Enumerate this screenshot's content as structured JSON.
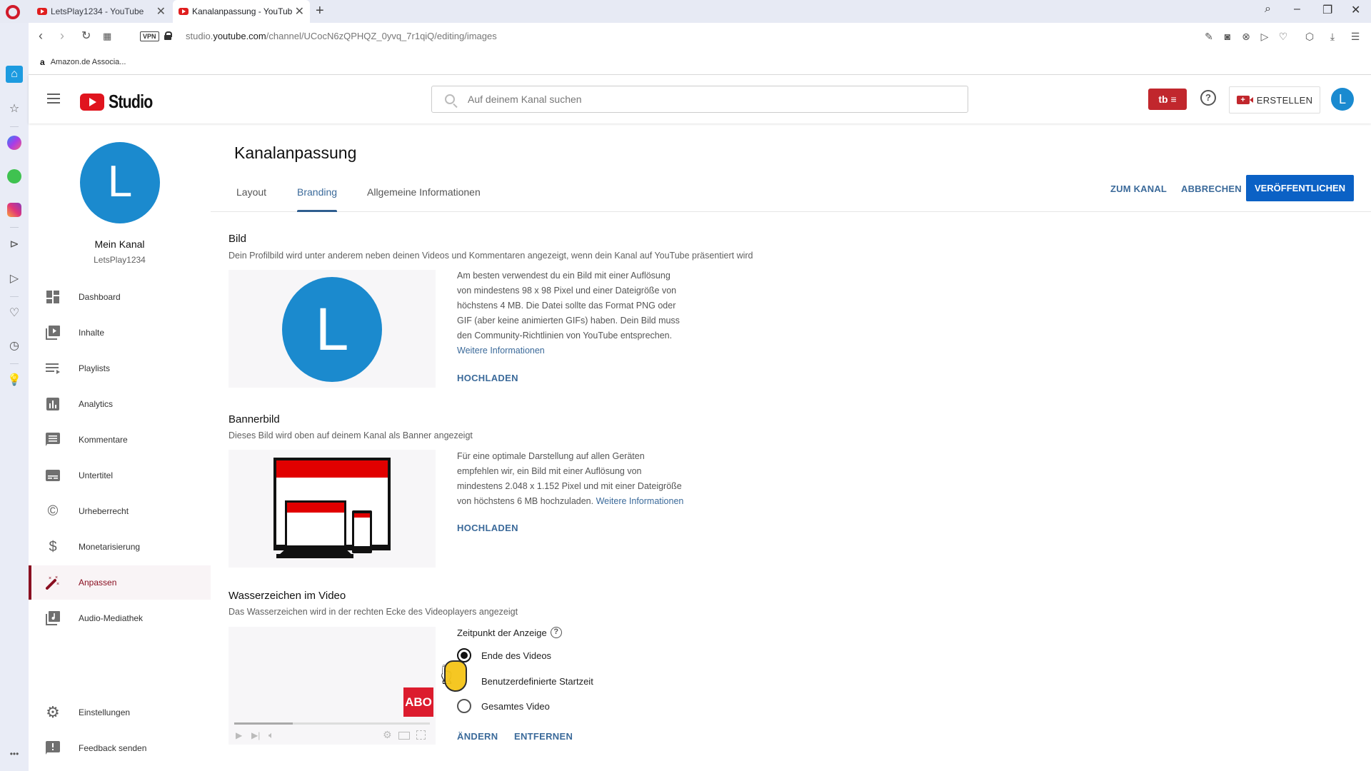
{
  "browser": {
    "tabs": [
      {
        "title": "LetsPlay1234 - YouTube",
        "active": false
      },
      {
        "title": "Kanalanpassung - YouTube",
        "active": true
      }
    ],
    "new_tab": "+",
    "url_prefix": "studio.",
    "url_domain": "youtube.com",
    "url_path": "/channel/UCocN6zQPHQZ_0yvq_7r1qiQ/editing/images",
    "vpn_label": "VPN",
    "bookmarks": [
      {
        "icon": "a",
        "label": "Amazon.de Associa..."
      }
    ],
    "window_controls": {
      "search": "⌕",
      "minimize": "–",
      "restore": "❐",
      "close": "✕"
    },
    "toolbar_icons": [
      "snapshot-edit",
      "camera",
      "adblock",
      "send",
      "heart",
      "cube",
      "download",
      "settings"
    ]
  },
  "opera_sidebar": {
    "items": [
      "home",
      "star",
      "messenger",
      "whatsapp",
      "instagram",
      "player",
      "send",
      "heart",
      "history",
      "tips"
    ],
    "more": "•••"
  },
  "header": {
    "logo_text": "Studio",
    "search_placeholder": "Auf deinem Kanal suchen",
    "tb_label": "tb ≡",
    "help": "?",
    "create_label": "ERSTELLEN",
    "avatar_letter": "L"
  },
  "nav": {
    "channel_avatar": "L",
    "channel_name": "Mein Kanal",
    "channel_handle": "LetsPlay1234",
    "items": [
      {
        "label": "Dashboard",
        "icon": "dashboard-icon"
      },
      {
        "label": "Inhalte",
        "icon": "content-icon"
      },
      {
        "label": "Playlists",
        "icon": "playlist-icon"
      },
      {
        "label": "Analytics",
        "icon": "analytics-icon"
      },
      {
        "label": "Kommentare",
        "icon": "comments-icon"
      },
      {
        "label": "Untertitel",
        "icon": "subtitles-icon"
      },
      {
        "label": "Urheberrecht",
        "icon": "copyright-icon"
      },
      {
        "label": "Monetarisierung",
        "icon": "dollar-icon"
      },
      {
        "label": "Anpassen",
        "icon": "magic-wand-icon",
        "active": true
      },
      {
        "label": "Audio-Mediathek",
        "icon": "audio-library-icon"
      }
    ],
    "bottom_items": [
      {
        "label": "Einstellungen",
        "icon": "gear-icon"
      },
      {
        "label": "Feedback senden",
        "icon": "feedback-icon"
      }
    ]
  },
  "main": {
    "title": "Kanalanpassung",
    "tabs": [
      {
        "label": "Layout",
        "active": false
      },
      {
        "label": "Branding",
        "active": true
      },
      {
        "label": "Allgemeine Informationen",
        "active": false
      }
    ],
    "actions": {
      "to_channel": "ZUM KANAL",
      "cancel": "ABBRECHEN",
      "publish": "VERÖFFENTLICHEN"
    },
    "accent_color": "#0b61c5",
    "sections": {
      "picture": {
        "title": "Bild",
        "description": "Dein Profilbild wird unter anderem neben deinen Videos und Kommentaren angezeigt, wenn dein Kanal auf YouTube präsentiert wird",
        "avatar_letter": "L",
        "info": "Am besten verwendest du ein Bild mit einer Auflösung von mindestens 98 x 98 Pixel und einer Dateigröße von höchstens 4 MB. Die Datei sollte das Format PNG oder GIF (aber keine animierten GIFs) haben. Dein Bild muss den Community-Richtlinien von YouTube entsprechen.",
        "info_lines": [
          "Am besten verwendest du ein Bild mit einer Auflösung",
          "von mindestens 98 x 98 Pixel und einer Dateigröße von",
          "höchstens 4 MB. Die Datei sollte das Format PNG oder",
          "GIF (aber keine animierten GIFs) haben. Dein Bild muss",
          "den Community-Richtlinien von YouTube entsprechen."
        ],
        "more_link": "Weitere Informationen",
        "upload": "HOCHLADEN"
      },
      "banner": {
        "title": "Bannerbild",
        "description": "Dieses Bild wird oben auf deinem Kanal als Banner angezeigt",
        "info_lines": [
          "Für eine optimale Darstellung auf allen Geräten",
          "empfehlen wir, ein Bild mit einer Auflösung von",
          "mindestens 2.048 x 1.152 Pixel und mit einer Dateigröße",
          "von höchstens 6 MB hochzuladen."
        ],
        "more_link": "Weitere Informationen",
        "upload": "HOCHLADEN"
      },
      "watermark": {
        "title": "Wasserzeichen im Video",
        "description": "Das Wasserzeichen wird in der rechten Ecke des Videoplayers angezeigt",
        "badge": "ABO",
        "timing_label": "Zeitpunkt der Anzeige",
        "options": [
          {
            "label": "Ende des Videos",
            "selected": true
          },
          {
            "label": "Benutzerdefinierte Startzeit",
            "selected": false
          },
          {
            "label": "Gesamtes Video",
            "selected": false
          }
        ],
        "player_progress": 0.3,
        "change": "ÄNDERN",
        "remove": "ENTFERNEN"
      }
    }
  }
}
